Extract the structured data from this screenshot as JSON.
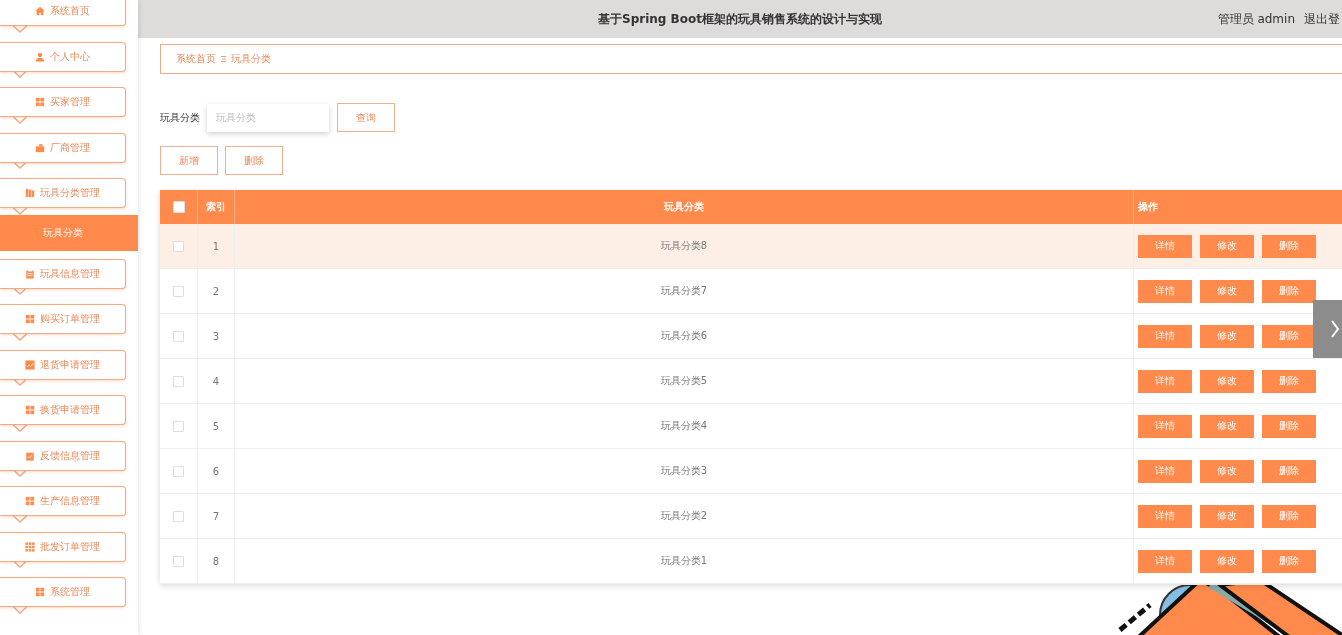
{
  "header": {
    "title": "基于Spring Boot框架的玩具销售系统的设计与实现",
    "user": "管理员 admin",
    "logout": "退出登"
  },
  "sidebar": {
    "items": [
      {
        "label": "系统首页",
        "kind": "home",
        "selected": false
      },
      {
        "label": "个人中心",
        "kind": "user",
        "selected": false
      },
      {
        "label": "买家管理",
        "kind": "grid",
        "selected": false
      },
      {
        "label": "厂商管理",
        "kind": "case",
        "selected": false
      },
      {
        "label": "玩具分类管理",
        "kind": "books",
        "selected": false
      },
      {
        "label": "玩具分类",
        "kind": "submenu",
        "selected": true
      },
      {
        "label": "玩具信息管理",
        "kind": "clipboard",
        "selected": false
      },
      {
        "label": "购买订单管理",
        "kind": "grid",
        "selected": false
      },
      {
        "label": "退货申请管理",
        "kind": "chart",
        "selected": false
      },
      {
        "label": "换货申请管理",
        "kind": "grid",
        "selected": false
      },
      {
        "label": "反馈信息管理",
        "kind": "clipcheck",
        "selected": false
      },
      {
        "label": "生产信息管理",
        "kind": "grid",
        "selected": false
      },
      {
        "label": "批发订单管理",
        "kind": "grid9",
        "selected": false
      },
      {
        "label": "系统管理",
        "kind": "grid",
        "selected": false
      }
    ]
  },
  "breadcrumb": [
    "系统首页",
    "玩具分类"
  ],
  "search": {
    "label": "玩具分类",
    "placeholder": "玩具分类",
    "button": "查询"
  },
  "actions": [
    "新增",
    "删除"
  ],
  "table": {
    "all_checked": false,
    "columns": [
      "索引",
      "玩具分类",
      "操作"
    ],
    "rows": [
      {
        "index": "1",
        "name": "玩具分类8",
        "checked": false,
        "highlighted": true,
        "buttons": [
          "详情",
          "修改",
          "删除"
        ]
      },
      {
        "index": "2",
        "name": "玩具分类7",
        "checked": false,
        "highlighted": false,
        "buttons": [
          "详情",
          "修改",
          "删除"
        ]
      },
      {
        "index": "3",
        "name": "玩具分类6",
        "checked": false,
        "highlighted": false,
        "buttons": [
          "详情",
          "修改",
          "删除"
        ]
      },
      {
        "index": "4",
        "name": "玩具分类5",
        "checked": false,
        "highlighted": false,
        "buttons": [
          "详情",
          "修改",
          "删除"
        ]
      },
      {
        "index": "5",
        "name": "玩具分类4",
        "checked": false,
        "highlighted": false,
        "buttons": [
          "详情",
          "修改",
          "删除"
        ]
      },
      {
        "index": "6",
        "name": "玩具分类3",
        "checked": false,
        "highlighted": false,
        "buttons": [
          "详情",
          "修改",
          "删除"
        ]
      },
      {
        "index": "7",
        "name": "玩具分类2",
        "checked": false,
        "highlighted": false,
        "buttons": [
          "详情",
          "修改",
          "删除"
        ]
      },
      {
        "index": "8",
        "name": "玩具分类1",
        "checked": false,
        "highlighted": false,
        "buttons": [
          "详情",
          "修改",
          "删除"
        ]
      }
    ]
  }
}
